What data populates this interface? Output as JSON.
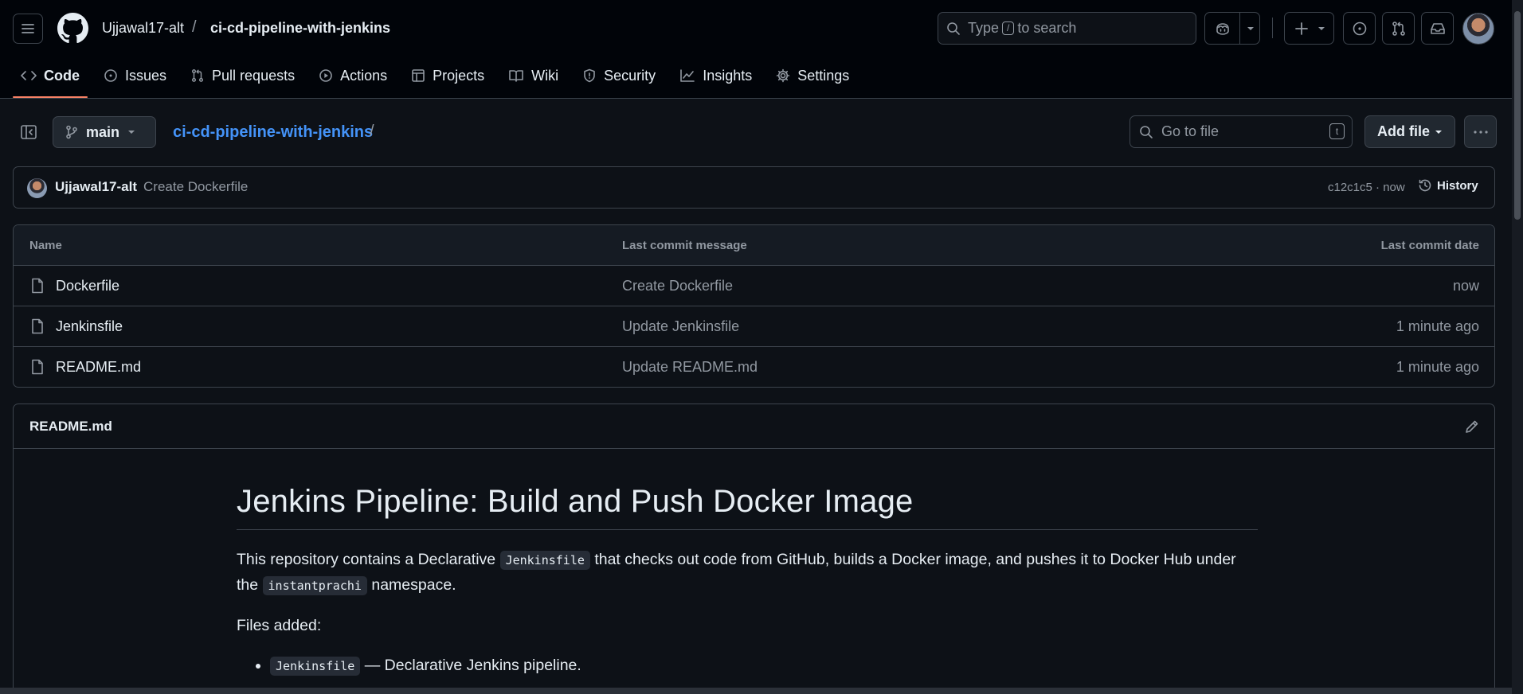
{
  "header": {
    "owner": "Ujjawal17-alt",
    "separator": "/",
    "repo": "ci-cd-pipeline-with-jenkins",
    "search_prefix": "Type",
    "search_key": "/",
    "search_suffix": "to search"
  },
  "repo_nav": [
    {
      "label": "Code",
      "icon": "code-icon"
    },
    {
      "label": "Issues",
      "icon": "issue-icon"
    },
    {
      "label": "Pull requests",
      "icon": "pull-request-icon"
    },
    {
      "label": "Actions",
      "icon": "play-icon"
    },
    {
      "label": "Projects",
      "icon": "table-icon"
    },
    {
      "label": "Wiki",
      "icon": "book-icon"
    },
    {
      "label": "Security",
      "icon": "shield-icon"
    },
    {
      "label": "Insights",
      "icon": "graph-icon"
    },
    {
      "label": "Settings",
      "icon": "gear-icon"
    }
  ],
  "subheader": {
    "branch": "main",
    "path_repo": "ci-cd-pipeline-with-jenkins",
    "path_slash": "/",
    "goto_placeholder": "Go to file",
    "goto_key": "t",
    "add_file": "Add file"
  },
  "commit": {
    "author": "Ujjawal17-alt",
    "message": "Create Dockerfile",
    "meta": "c12c1c5 · now",
    "history": "History"
  },
  "file_table": {
    "headers": {
      "name": "Name",
      "message": "Last commit message",
      "date": "Last commit date"
    },
    "rows": [
      {
        "name": "Dockerfile",
        "message": "Create Dockerfile",
        "date": "now"
      },
      {
        "name": "Jenkinsfile",
        "message": "Update Jenkinsfile",
        "date": "1 minute ago"
      },
      {
        "name": "README.md",
        "message": "Update README.md",
        "date": "1 minute ago"
      }
    ]
  },
  "readme": {
    "title": "README.md",
    "h1": "Jenkins Pipeline: Build and Push Docker Image",
    "p1_a": "This repository contains a Declarative ",
    "p1_code1": "Jenkinsfile",
    "p1_b": " that checks out code from GitHub, builds a Docker image, and pushes it to Docker Hub under the ",
    "p1_code2": "instantprachi",
    "p1_c": " namespace.",
    "p2": "Files added:",
    "li1_code": "Jenkinsfile",
    "li1_text": " — Declarative Jenkins pipeline."
  },
  "colors": {
    "background": "#0d1117",
    "header_bg": "#010409",
    "border": "#3d444d",
    "link": "#4493f8",
    "active_tab_underline": "#f78166",
    "muted_text": "#9198a1"
  }
}
